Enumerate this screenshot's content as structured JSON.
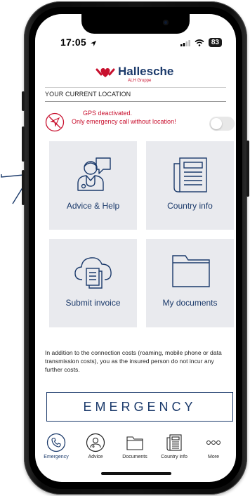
{
  "status": {
    "time": "17:05",
    "battery": "83"
  },
  "logo": {
    "name": "Hallesche",
    "subtitle": "ALH Gruppe"
  },
  "location": {
    "section_title": "YOUR CURRENT LOCATION",
    "gps_line1": "GPS deactivated.",
    "gps_line2": "Only emergency call without location!",
    "gps_toggle_on": false
  },
  "tiles": [
    {
      "label": "Advice & Help",
      "icon": "doctor-chat-icon"
    },
    {
      "label": "Country info",
      "icon": "newspaper-icon"
    },
    {
      "label": "Submit invoice",
      "icon": "cloud-document-icon"
    },
    {
      "label": "My documents",
      "icon": "folder-icon"
    }
  ],
  "disclaimer": "In addition to the connection costs (roaming, mobile phone or data transmission costs), you as the insured person do not incur any further costs.",
  "emergency_button": "EMERGENCY",
  "tabs": [
    {
      "label": "Emergency",
      "icon": "phone-icon",
      "active": true
    },
    {
      "label": "Advice",
      "icon": "doctor-icon",
      "active": false
    },
    {
      "label": "Documents",
      "icon": "folder-icon",
      "active": false
    },
    {
      "label": "Country info",
      "icon": "newspaper-icon",
      "active": false
    },
    {
      "label": "More",
      "icon": "more-dots-icon",
      "active": false
    }
  ],
  "colors": {
    "brand_blue": "#1b3a6b",
    "brand_red": "#c8102e",
    "tile_bg": "#e9eaee"
  }
}
